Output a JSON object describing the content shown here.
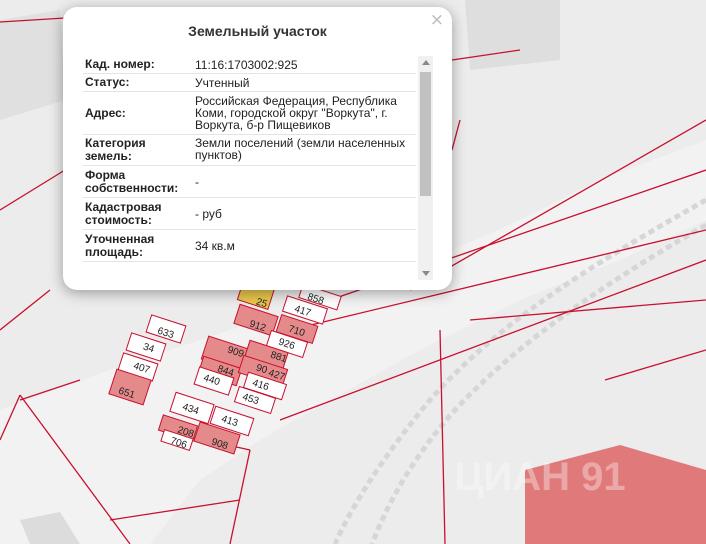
{
  "popup": {
    "title": "Земельный участок",
    "close_symbol": "×",
    "rows": [
      {
        "label": "Кад. номер:",
        "value": "11:16:1703002:925"
      },
      {
        "label": "Статус:",
        "value": "Учтенный"
      },
      {
        "label": "Адрес:",
        "value": "Российская Федерация, Республика Коми, городской округ \"Воркута\", г. Воркута, б-р Пищевиков"
      },
      {
        "label": "Категория земель:",
        "value": "Земли поселений (земли населенных пунктов)"
      },
      {
        "label": "Форма собственности:",
        "value": "-"
      },
      {
        "label": "Кадастровая стоимость:",
        "value": "- руб"
      },
      {
        "label": "Уточненная площадь:",
        "value": "34 кв.м"
      }
    ]
  },
  "map": {
    "colors": {
      "background": "#ececec",
      "boundary": "#c8102e",
      "parcel_fill": "#e58a8a",
      "selected_fill": "#e8c74c",
      "building": "#dcdcdc",
      "railway": "#d8d8d8",
      "large_area": "#e07a7a"
    },
    "parcel_labels": [
      {
        "text": "633"
      },
      {
        "text": "34"
      },
      {
        "text": "407"
      },
      {
        "text": "651"
      },
      {
        "text": "858"
      },
      {
        "text": "417"
      },
      {
        "text": "25"
      },
      {
        "text": "912"
      },
      {
        "text": "710"
      },
      {
        "text": "926"
      },
      {
        "text": "909"
      },
      {
        "text": "881"
      },
      {
        "text": "844"
      },
      {
        "text": "90"
      },
      {
        "text": "427"
      },
      {
        "text": "416"
      },
      {
        "text": "440"
      },
      {
        "text": "453"
      },
      {
        "text": "434"
      },
      {
        "text": "413"
      },
      {
        "text": "208"
      },
      {
        "text": "908"
      },
      {
        "text": "706"
      }
    ],
    "watermark": "ЦИАН 91"
  }
}
